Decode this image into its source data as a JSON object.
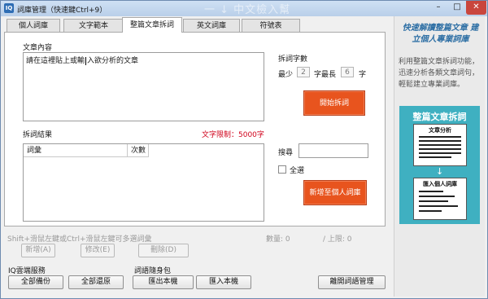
{
  "window": {
    "icon": "IQ",
    "title": "詞庫管理（快速鍵Ctrl+9）",
    "title_deco": "一 ↓ 中文檢入幫",
    "controls": {
      "minimize": "–",
      "maximize": "□",
      "close": "✕"
    }
  },
  "tabs": [
    {
      "label": "個人詞庫",
      "active": false
    },
    {
      "label": "文字範本",
      "active": false
    },
    {
      "label": "整篇文章拆詞",
      "active": true
    },
    {
      "label": "英文詞庫",
      "active": false
    },
    {
      "label": "符號表",
      "active": false
    }
  ],
  "main": {
    "content_label": "文章內容",
    "content_text_before": "請在這裡貼上或輸",
    "content_text_after": "入欲分析的文章",
    "split_count_label": "拆詞字數",
    "min_label": "最少",
    "min_value": "2",
    "max_prefix": "字最長",
    "max_value": "6",
    "max_suffix": "字",
    "start_button": "開始拆詞",
    "result_label": "拆詞結果",
    "limit_label": "文字限制：5000字",
    "col_word": "詞彙",
    "col_count": "次數",
    "search_label": "搜尋",
    "select_all_label": "全選",
    "add_button": "新增至個人詞庫"
  },
  "status": {
    "hint": "Shift+滑鼠左鍵或Ctrl+滑鼠左鍵可多選詞彙",
    "count": "數量: 0",
    "limit": "/ 上限: 0"
  },
  "edit_buttons": {
    "add": "新增(A)",
    "modify": "修改(E)",
    "delete": "刪除(D)"
  },
  "cloud": {
    "label": "IQ雲端服務",
    "backup": "全部備份",
    "restore": "全部還原"
  },
  "portable": {
    "label": "詞語隨身包",
    "export": "匯出本機",
    "import": "匯入本機"
  },
  "close_button": "離開詞語管理",
  "sidebar": {
    "title": "快速解讀整篇文章 建立個人專業詞庫",
    "desc": "利用整篇文章拆詞功能，迅速分析各類文章詞句，輕鬆建立專業詞庫。",
    "card_title": "整篇文章拆詞",
    "card_doc_title": "文章分析",
    "card_arrow": "↓",
    "card_lib_title": "匯入個人詞庫"
  }
}
